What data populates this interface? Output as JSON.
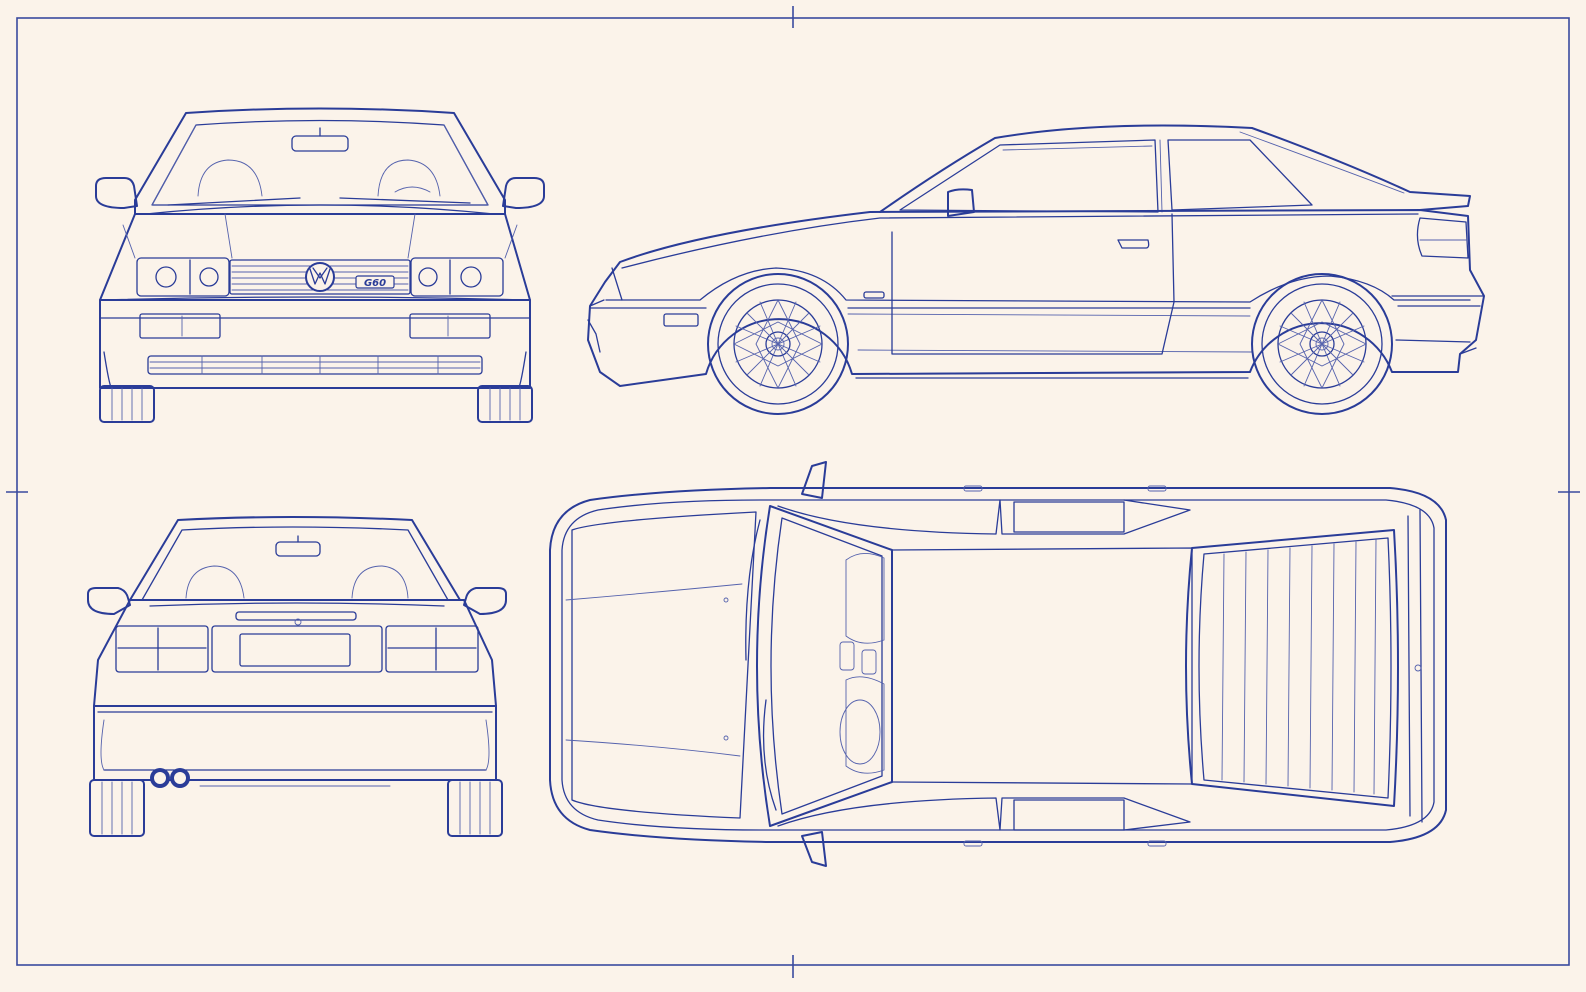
{
  "sheet": {
    "background": "#fbf3ea",
    "line_color": "#2a3c98",
    "views": [
      "front",
      "side",
      "rear",
      "top"
    ]
  },
  "badges": {
    "front_model": "G60"
  },
  "icons": {
    "front_logo": "vw-logo-icon"
  }
}
